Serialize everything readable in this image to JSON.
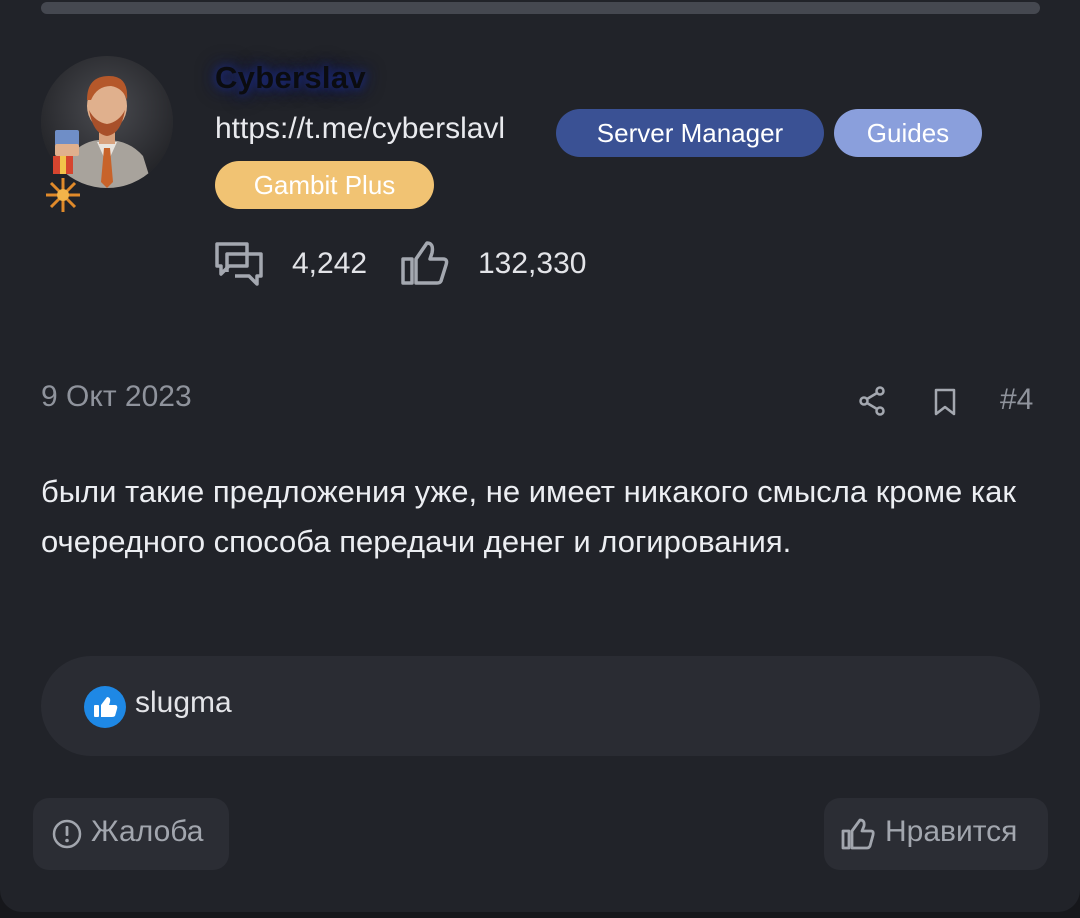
{
  "author": {
    "name": "Cyberslav",
    "link": "https://t.me/cyberslavl",
    "badges": [
      {
        "label": "Server Manager",
        "color": "#3a5194"
      },
      {
        "label": "Guides",
        "color": "#8a9fdc"
      },
      {
        "label": "Gambit Plus",
        "color": "#f1c373"
      }
    ],
    "stats": {
      "messages": "4,242",
      "reactions": "132,330"
    },
    "avatar_icon": "avatar-man-with-beard",
    "medal_icon": "medal-icon"
  },
  "post": {
    "date": "9 Окт 2023",
    "number": "#4",
    "body": "были такие предложения уже, не имеет никакого смысла кроме как очередного способа передачи денег и логирования.",
    "actions": [
      "share-icon",
      "bookmark-icon"
    ]
  },
  "likes": {
    "users": [
      "slugma"
    ],
    "icon_color": "#1e88e5"
  },
  "footer": {
    "report_label": "Жалоба",
    "like_label": "Нравится"
  },
  "colors": {
    "background": "#212329",
    "text": "#eceef2",
    "muted": "#8f939c"
  }
}
